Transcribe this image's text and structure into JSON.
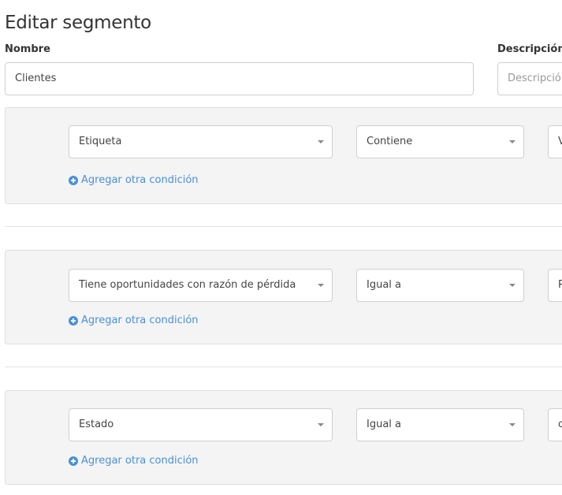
{
  "page": {
    "title": "Editar segmento"
  },
  "form": {
    "name_label": "Nombre",
    "name_value": "Clientes",
    "description_label": "Descripción",
    "description_placeholder": "Descripción"
  },
  "groups": [
    {
      "field": "Etiqueta",
      "operator": "Contiene",
      "value": "V",
      "add_condition": "Agregar otra condición"
    },
    {
      "field": "Tiene oportunidades con razón de pérdida",
      "operator": "Igual a",
      "value": "P",
      "add_condition": "Agregar otra condición"
    },
    {
      "field": "Estado",
      "operator": "Igual a",
      "value": "c",
      "add_condition": "Agregar otra condición"
    }
  ],
  "colors": {
    "link": "#4a90d9",
    "group_bg": "#f4f4f4",
    "border": "#cfcfcf"
  }
}
